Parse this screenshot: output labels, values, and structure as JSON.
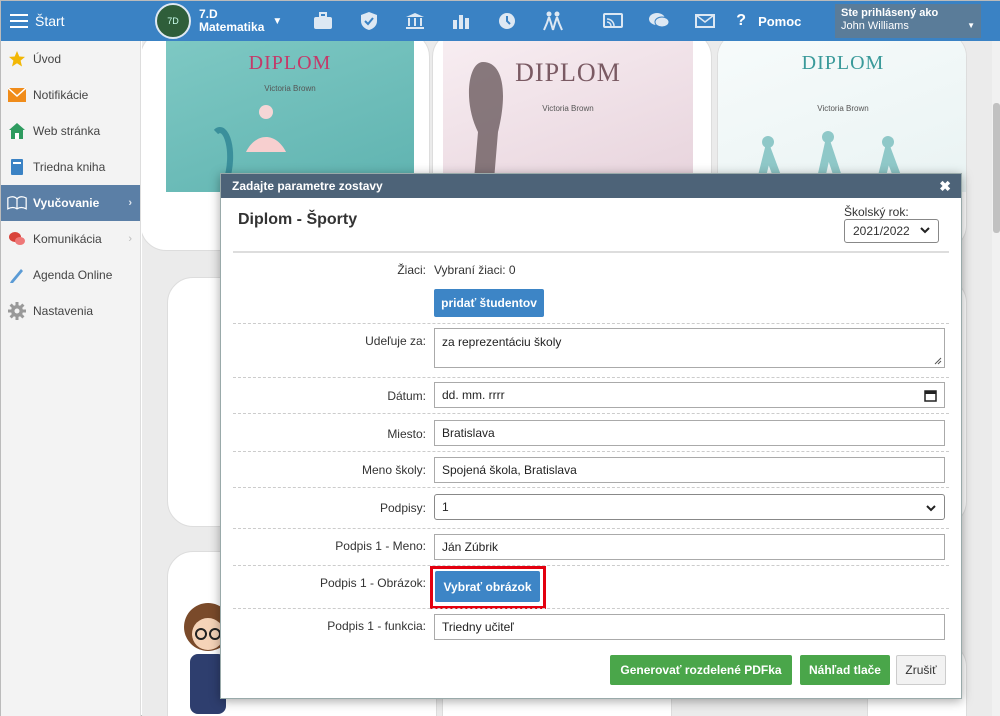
{
  "topbar": {
    "start_label": "Štart",
    "class_avatar_text": "7D",
    "class_name": "7.D",
    "class_subject": "Matematika",
    "help_label": "Pomoc",
    "user_line1": "Ste prihlásený ako",
    "user_line2": "John Williams",
    "icons": [
      "briefcase-icon",
      "shield-icon",
      "bank-icon",
      "bar-chart-icon",
      "clock-icon",
      "people-walk-icon",
      "cast-icon",
      "chat-icon",
      "mail-icon"
    ]
  },
  "sidebar": {
    "items": [
      {
        "label": "Úvod",
        "icon": "star-icon"
      },
      {
        "label": "Notifikácie",
        "icon": "envelope-icon"
      },
      {
        "label": "Web stránka",
        "icon": "house-icon"
      },
      {
        "label": "Triedna kniha",
        "icon": "book-icon"
      },
      {
        "label": "Vyučovanie",
        "icon": "open-book-icon",
        "active": true
      },
      {
        "label": "Komunikácia",
        "icon": "chat-bubbles-icon"
      },
      {
        "label": "Agenda Online",
        "icon": "pen-icon"
      },
      {
        "label": "Nastavenia",
        "icon": "gear-icon"
      }
    ]
  },
  "certificates": [
    {
      "title": "DIPLOM",
      "name": "Victoria Brown",
      "color": "#c33a6a"
    },
    {
      "title": "DIPLOM",
      "name": "Victoria Brown",
      "color": "#7a5a63"
    },
    {
      "title": "DIPLOM",
      "name": "Victoria Brown",
      "color": "#3a9a9a"
    }
  ],
  "modal": {
    "header": "Zadajte parametre zostavy",
    "title": "Diplom - Športy",
    "year_label": "Školský rok:",
    "year_value": "2021/2022",
    "students_label": "Žiaci:",
    "students_value": "Vybraní žiaci: 0",
    "add_students_btn": "pridať študentov",
    "awarded_for_label": "Udeľuje za:",
    "awarded_for_value": "za reprezentáciu školy",
    "date_label": "Dátum:",
    "date_placeholder": "dd. mm. rrrr",
    "place_label": "Miesto:",
    "place_value": "Bratislava",
    "school_label": "Meno školy:",
    "school_value": "Spojená škola, Bratislava",
    "signatures_label": "Podpisy:",
    "signatures_value": "1",
    "sig1_name_label": "Podpis 1 - Meno:",
    "sig1_name_value": "Ján Zúbrik",
    "sig1_image_label": "Podpis 1 - Obrázok:",
    "sig1_image_btn": "Vybrať obrázok",
    "sig1_role_label": "Podpis 1 - funkcia:",
    "sig1_role_value": "Triedny učiteľ",
    "btn_generate": "Generovať rozdelené PDFka",
    "btn_preview": "Náhľad tlače",
    "btn_cancel": "Zrušiť"
  },
  "colors": {
    "topbar": "#3a82c4",
    "modal_header": "#4d6378",
    "sidebar_active": "#5b7fa6",
    "button_blue": "#3d85c6",
    "button_green": "#4aa64a",
    "highlight": "#e3000f"
  }
}
